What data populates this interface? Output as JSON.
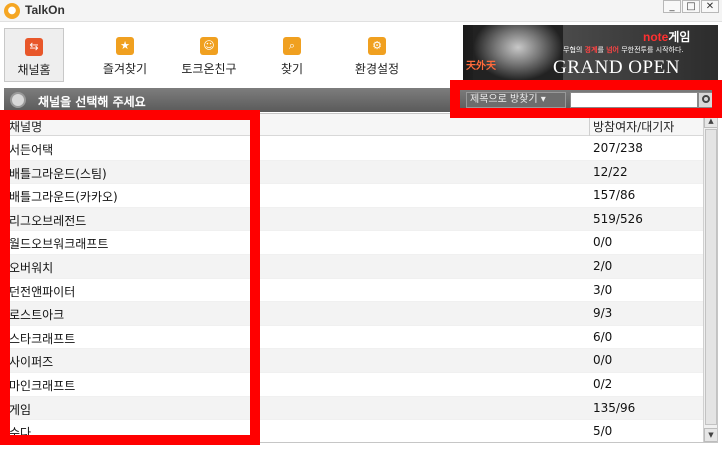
{
  "app": {
    "title": "TalkOn"
  },
  "window_controls": {
    "minimize": "_",
    "maximize": "□",
    "close": "✕"
  },
  "toolbar": {
    "items": [
      {
        "label": "채널홈",
        "icon": "channel-home-icon",
        "glyph": "⇆",
        "color": "#e8572a",
        "active": true
      },
      {
        "label": "즐겨찾기",
        "icon": "star-icon",
        "glyph": "★",
        "color": "#f0a020",
        "active": false
      },
      {
        "label": "토크온친구",
        "icon": "smiley-icon",
        "glyph": "☺",
        "color": "#f0a020",
        "active": false
      },
      {
        "label": "찾기",
        "icon": "magnifier-icon",
        "glyph": "⌕",
        "color": "#f0a020",
        "active": false
      },
      {
        "label": "환경설정",
        "icon": "settings-gear-icon",
        "glyph": "⚙",
        "color": "#f0a020",
        "active": false
      }
    ]
  },
  "banner": {
    "brand_note": "note",
    "brand_game": "게임",
    "tagline_prefix": "무협의 ",
    "tagline_highlight1": "경계",
    "tagline_mid": "를 ",
    "tagline_highlight2": "넘어",
    "tagline_suffix": " 무한전투를 시작하다.",
    "title": "GRAND OPEN",
    "game_logo": "天外天"
  },
  "subheader": {
    "title": "채널을 선택해 주세요",
    "search_mode": "제목으로 방찾기 ▾",
    "search_value": ""
  },
  "table": {
    "columns": [
      "채널명",
      "방참여자/대기자"
    ],
    "rows": [
      {
        "name": "서든어택",
        "count": "207/238"
      },
      {
        "name": "배틀그라운드(스팀)",
        "count": "12/22"
      },
      {
        "name": "배틀그라운드(카카오)",
        "count": "157/86"
      },
      {
        "name": "리그오브레전드",
        "count": "519/526"
      },
      {
        "name": "월드오브워크래프트",
        "count": "0/0"
      },
      {
        "name": "오버워치",
        "count": "2/0"
      },
      {
        "name": "던전앤파이터",
        "count": "3/0"
      },
      {
        "name": "로스트아크",
        "count": "9/3"
      },
      {
        "name": "스타크래프트",
        "count": "6/0"
      },
      {
        "name": "사이퍼즈",
        "count": "0/0"
      },
      {
        "name": "마인크래프트",
        "count": "0/2"
      },
      {
        "name": "게임",
        "count": "135/96"
      },
      {
        "name": "수다",
        "count": "5/0"
      }
    ]
  },
  "scrollbar": {
    "up": "▲",
    "down": "▼"
  },
  "colors": {
    "redaction": "#ff0000",
    "header_bar": "#666666"
  }
}
